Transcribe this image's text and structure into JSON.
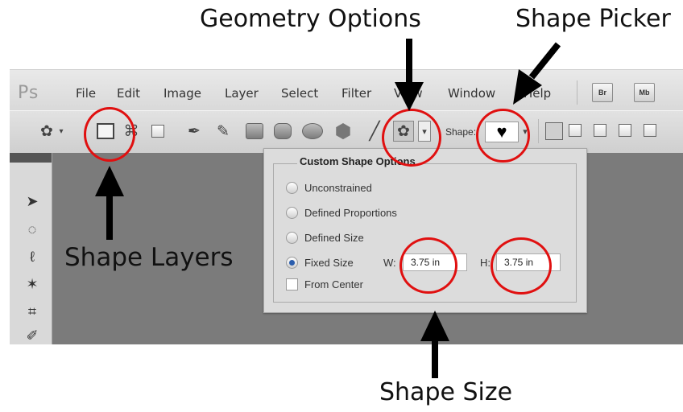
{
  "annotations": {
    "geometry_options": "Geometry Options",
    "shape_picker": "Shape Picker",
    "shape_layers": "Shape Layers",
    "shape_size": "Shape Size"
  },
  "app": {
    "logo": "Ps",
    "menu": [
      "File",
      "Edit",
      "Image",
      "Layer",
      "Select",
      "Filter",
      "View",
      "Window",
      "Help"
    ],
    "bridge_button": "Br",
    "minibridge_button": "Mb"
  },
  "options_bar": {
    "shape_label": "Shape:"
  },
  "custom_shape_options": {
    "title": "Custom Shape Options",
    "unconstrained": "Unconstrained",
    "defined_proportions": "Defined Proportions",
    "defined_size": "Defined Size",
    "fixed_size": "Fixed Size",
    "selected_option": "Fixed Size",
    "w_label": "W:",
    "h_label": "H:",
    "width": "3.75 in",
    "height": "3.75 in",
    "from_center": "From Center",
    "from_center_checked": false
  },
  "colors": {
    "highlight_circle": "#e01010",
    "radio_selected": "#2a5dad",
    "canvas": "#7b7b7b"
  }
}
